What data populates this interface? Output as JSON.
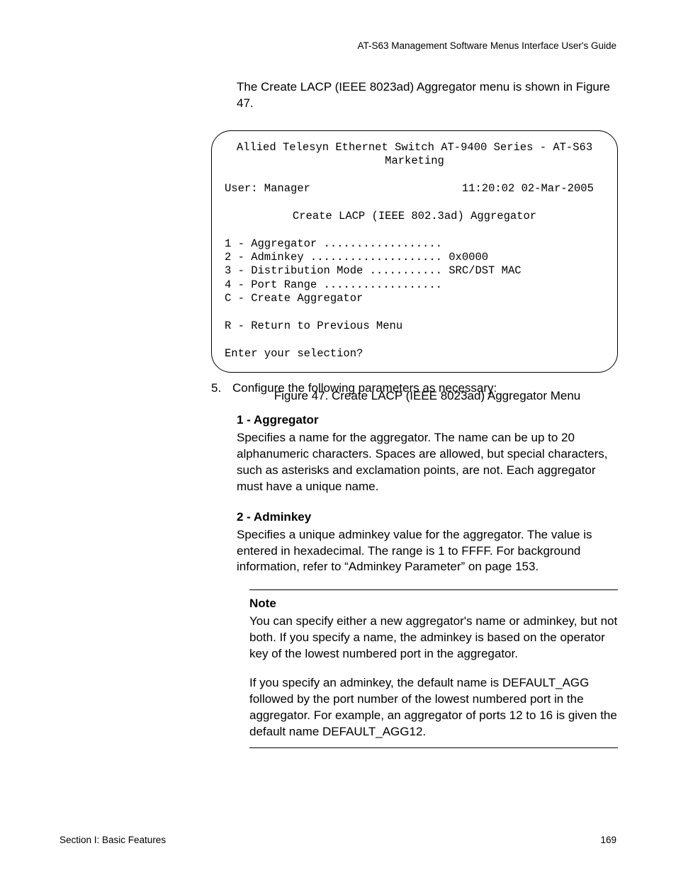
{
  "header": {
    "guide_title": "AT-S63 Management Software Menus Interface User's Guide"
  },
  "intro": "The Create LACP (IEEE 8023ad) Aggregator menu is shown in Figure 47.",
  "terminal": {
    "title_line1": "Allied Telesyn Ethernet Switch AT-9400 Series - AT-S63",
    "title_line2": "Marketing",
    "user_label": "User: Manager",
    "timestamp": "11:20:02 02-Mar-2005",
    "menu_title": "Create LACP (IEEE 802.3ad) Aggregator",
    "opt1": "1 - Aggregator ..................",
    "opt2": "2 - Adminkey .................... 0x0000",
    "opt3": "3 - Distribution Mode ........... SRC/DST MAC",
    "opt4": "4 - Port Range ..................",
    "optC": "C - Create Aggregator",
    "optR": "R - Return to Previous Menu",
    "prompt": "Enter your selection?"
  },
  "figure_caption": "Figure 47. Create LACP (IEEE 8023ad) Aggregator Menu",
  "step5": {
    "num": "5.",
    "text": "Configure the following parameters as necessary:"
  },
  "param1": {
    "title": "1 - Aggregator",
    "body": "Specifies a name for the aggregator. The name can be up to 20 alphanumeric characters. Spaces are allowed, but special characters, such as asterisks and exclamation points, are not. Each aggregator must have a unique name."
  },
  "param2": {
    "title": "2 - Adminkey",
    "body": "Specifies a unique adminkey value for the aggregator. The value is entered in hexadecimal. The range is 1 to FFFF. For background information, refer to “Adminkey Parameter” on page 153."
  },
  "note": {
    "title": "Note",
    "p1": "You can specify either a new aggregator's name or adminkey, but not both. If you specify a name, the adminkey is based on the operator key of the lowest numbered port in the aggregator.",
    "p2": "If you specify an adminkey, the default name is DEFAULT_AGG followed by the port number of the lowest numbered port in the aggregator. For example, an aggregator of ports 12 to 16 is given the default name DEFAULT_AGG12."
  },
  "footer": {
    "section": "Section I: Basic Features",
    "page": "169"
  }
}
